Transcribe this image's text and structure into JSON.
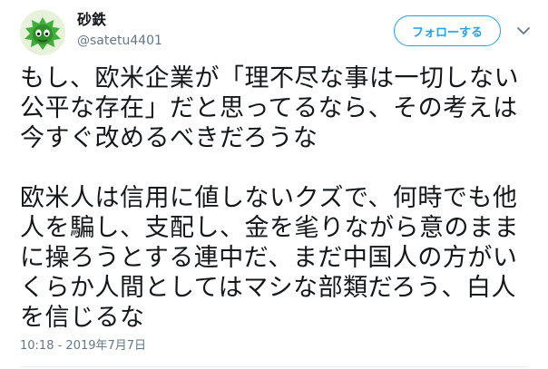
{
  "user": {
    "display_name": "砂鉄",
    "handle": "@satetu4401"
  },
  "actions": {
    "follow_label": "フォローする",
    "menu_icon": "chevron-down-icon"
  },
  "tweet": {
    "text": "もし、欧米企業が「理不尽な事は一切しない\n公平な存在」だと思ってるなら、その考えは\n今すぐ改めるべきだろうな\n\n欧米人は信用に値しないクズで、何時でも他\n人を騙し、支配し、金を毟りながら意のまま\nに操ろうとする連中だ、まだ中国人の方がい\nくらか人間としてはマシな部類だろう、白人\nを信じるな",
    "timestamp": "10:18 - 2019年7月7日"
  },
  "colors": {
    "accent": "#1da1f2",
    "text_primary": "#14171a",
    "text_secondary": "#657786",
    "divider": "#e6ecf0"
  }
}
